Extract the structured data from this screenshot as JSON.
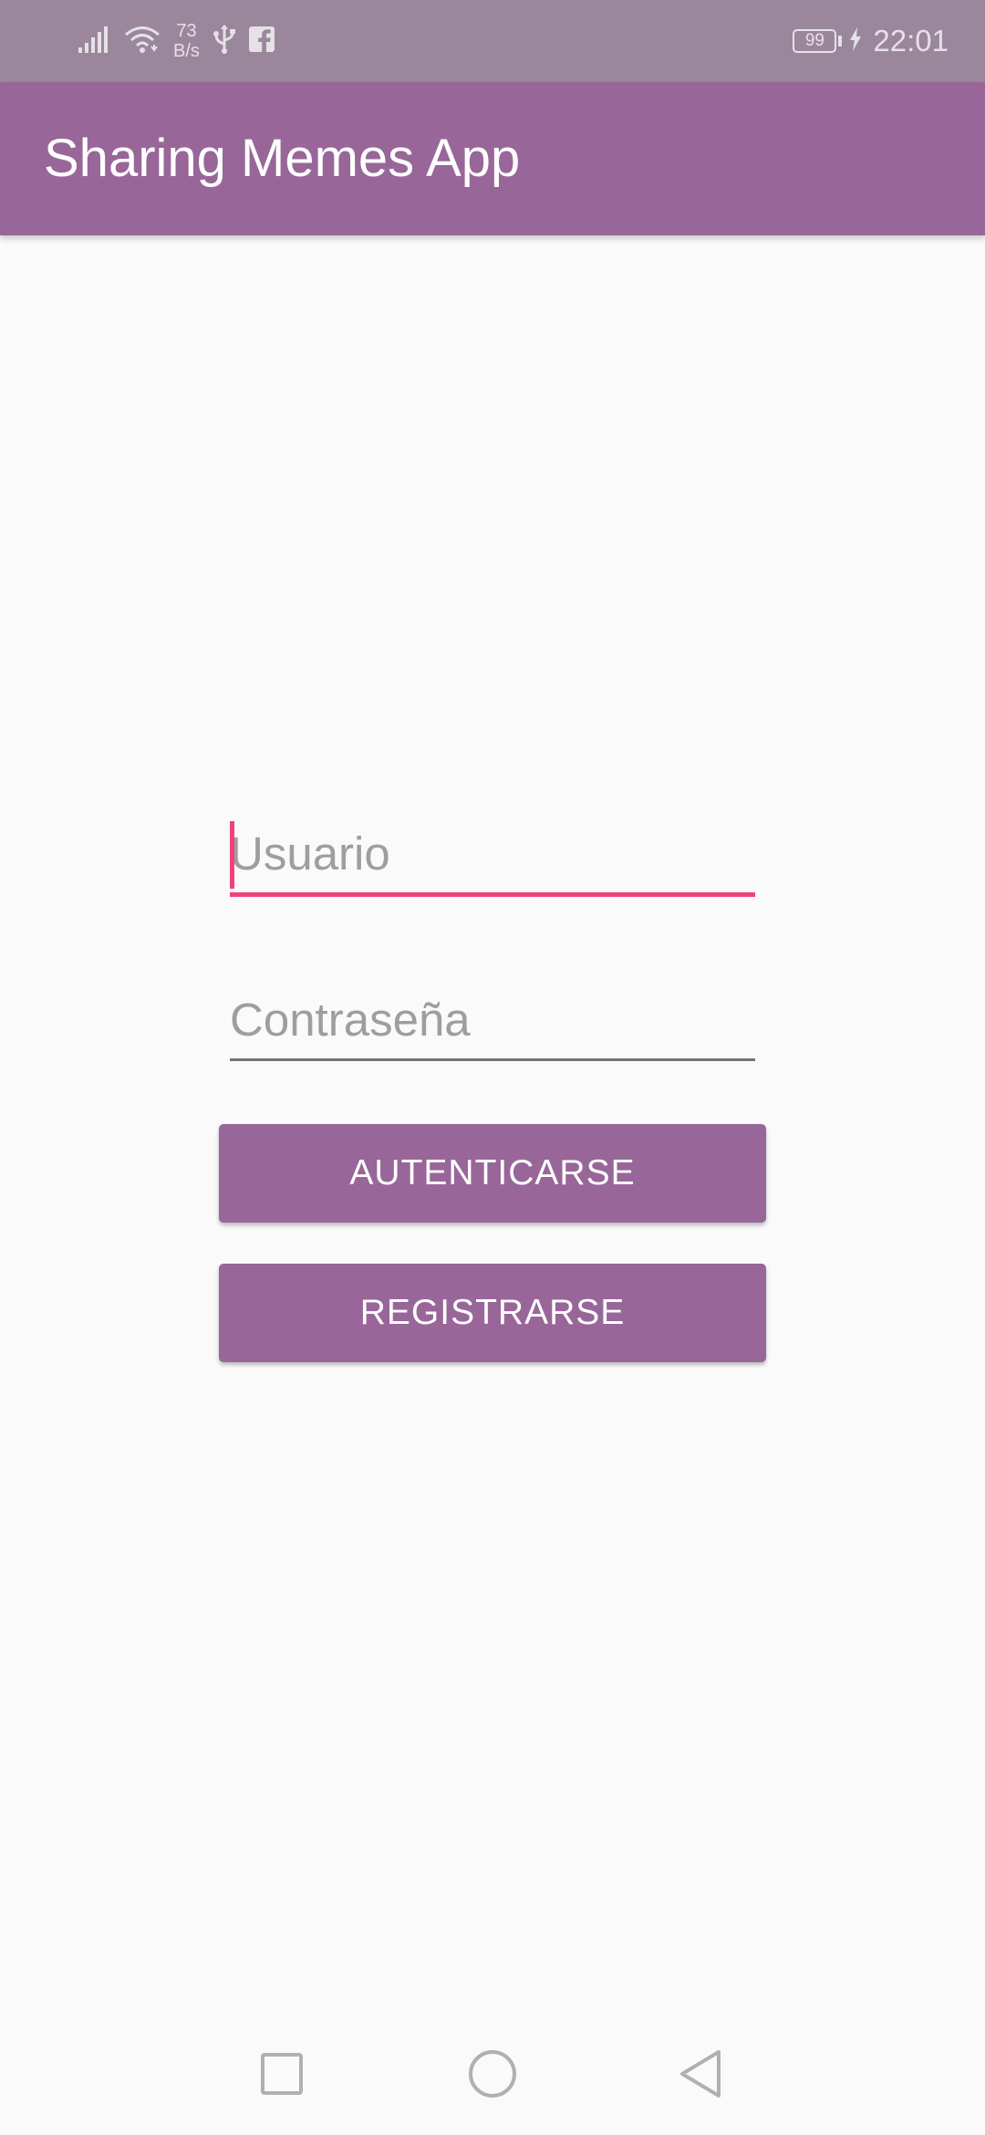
{
  "status_bar": {
    "net_speed_value": "73",
    "net_speed_unit": "B/s",
    "battery_level": "99",
    "time": "22:01",
    "icons": [
      "signal-icon",
      "wifi-icon",
      "usb-icon",
      "facebook-icon",
      "battery-icon",
      "charging-icon"
    ]
  },
  "app_bar": {
    "title": "Sharing Memes App",
    "color": "#986699"
  },
  "login_form": {
    "username": {
      "placeholder": "Usuario",
      "value": ""
    },
    "password": {
      "placeholder": "Contraseña",
      "value": ""
    },
    "login_button_label": "AUTENTICARSE",
    "register_button_label": "REGISTRARSE",
    "accent_color": "#f0427a"
  },
  "nav_bar": {
    "icons": [
      "recents-icon",
      "home-icon",
      "back-icon"
    ]
  }
}
